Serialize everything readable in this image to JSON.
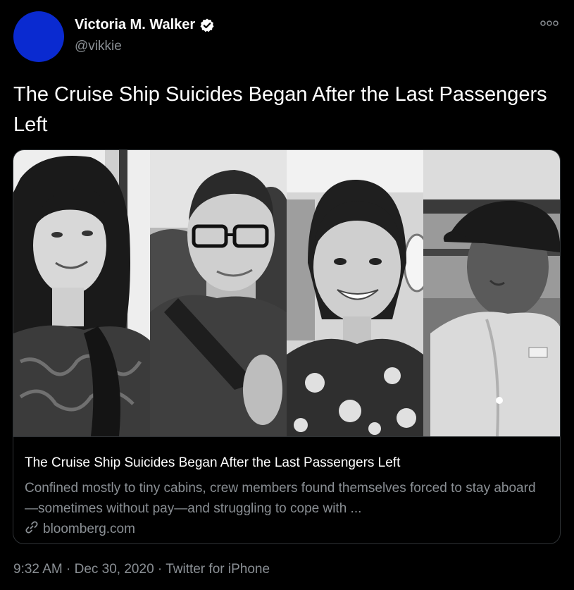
{
  "author": {
    "display_name": "Victoria M. Walker",
    "handle": "@vikkie",
    "avatar_color": "#0a2ad0",
    "verified_icon": "verified-badge-icon"
  },
  "tweet": {
    "text": "The Cruise Ship Suicides Began After the Last Passengers Left"
  },
  "card": {
    "title": "The Cruise Ship Suicides Began After the Last Passengers Left",
    "description": "Confined mostly to tiny cabins, crew members found themselves forced to stay aboard—sometimes without pay—and struggling to cope with ...",
    "domain": "bloomberg.com",
    "link_icon": "link-icon",
    "photos": [
      "photo-woman",
      "photo-man-glasses",
      "photo-woman-smiling",
      "photo-man-cap"
    ]
  },
  "meta": {
    "time": "9:32 AM",
    "separator": "·",
    "date": "Dec 30, 2020",
    "source": "Twitter for iPhone"
  },
  "colors": {
    "background": "#000000",
    "primary_text": "#ffffff",
    "secondary_text": "#8a8f94",
    "border": "#2f3336"
  }
}
